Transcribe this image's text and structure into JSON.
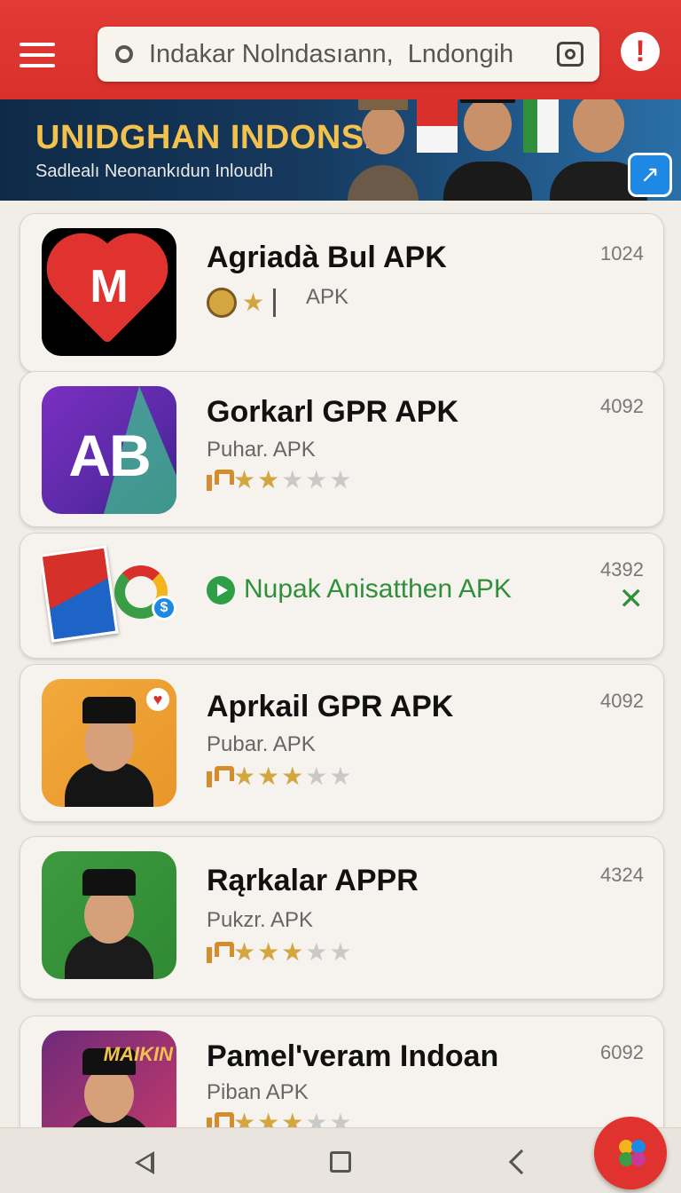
{
  "search": {
    "value": "Indakar Nolndasıann,  Lndongih"
  },
  "banner": {
    "title": "UNIDGHAN INDONSIA",
    "subtitle": "Sadlealı Neonankıdun Inloudh"
  },
  "apps": [
    {
      "title": "Agriadà Bul APK",
      "subtitle": "APK",
      "count": "1024",
      "rating": 1
    },
    {
      "title": "Gorkarl GPR APK",
      "subtitle": "Puhar. APK",
      "count": "4092",
      "rating": 2
    },
    {
      "title": "Nupak Anisatthen APK",
      "count": "4392"
    },
    {
      "title": "Aprkail GPR APK",
      "subtitle": "Pubar. APK",
      "count": "4092",
      "rating": 3
    },
    {
      "title": "Rąrkalar APPR",
      "subtitle": "Pukzr. APK",
      "count": "4324",
      "rating": 3
    },
    {
      "title": "Pamel'veram Indoan",
      "subtitle": "Piban APK",
      "count": "6092",
      "rating": 3
    }
  ],
  "icons": {
    "app1_letter": "M",
    "app2_letters": "AB",
    "app6_word": "MAIKIN"
  },
  "colors": {
    "topbar": "#d9302c",
    "star": "#d4a640",
    "green": "#2f8f3a"
  }
}
